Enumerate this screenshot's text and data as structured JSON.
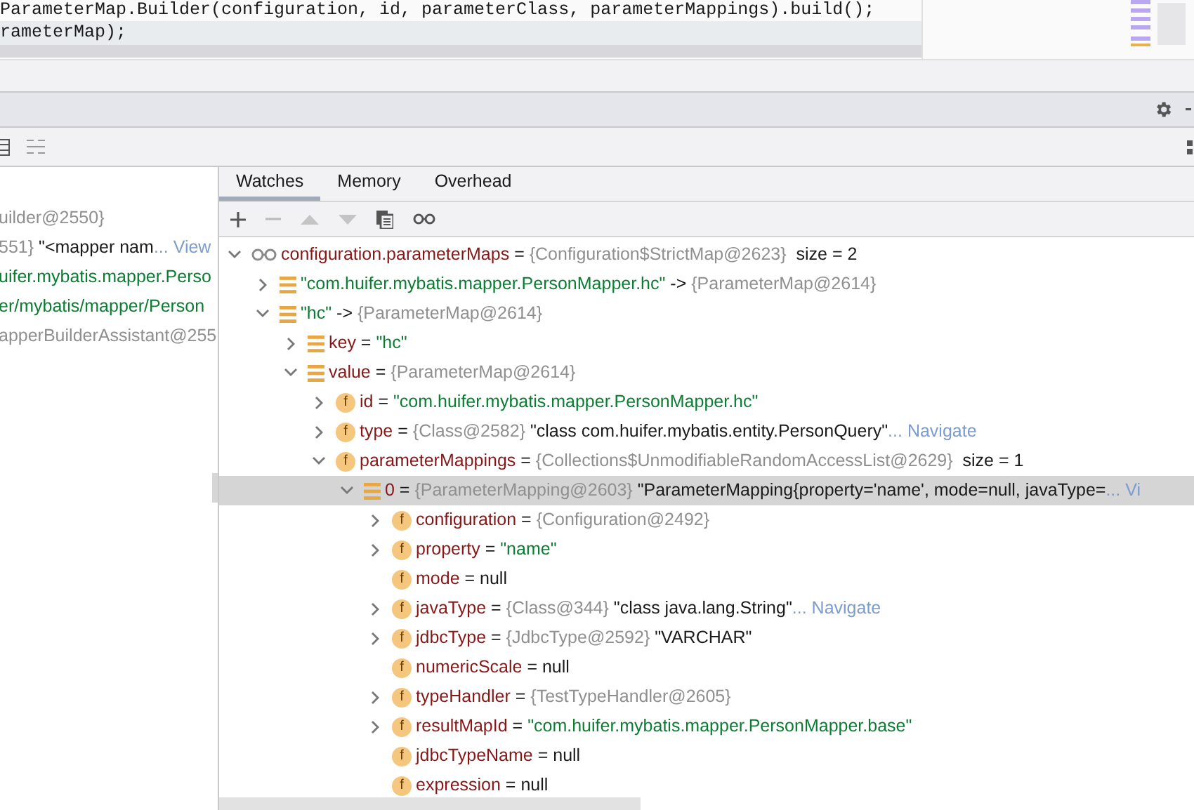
{
  "editor": {
    "lines": [
      {
        "text": "ParameterMap.Builder(configuration, id, parameterClass, parameterMappings).build();",
        "current": false
      },
      {
        "text": "rameterMap);",
        "current": true
      }
    ]
  },
  "frames": [
    {
      "parts": [
        {
          "t": "uilder@2550}",
          "kind": "ref"
        }
      ]
    },
    {
      "parts": [
        {
          "t": "551} ",
          "kind": "ref"
        },
        {
          "t": "\"<mapper nam",
          "kind": "plain"
        },
        {
          "t": "... View",
          "kind": "link"
        }
      ]
    },
    {
      "parts": [
        {
          "t": "uifer.mybatis.mapper.Perso",
          "kind": "string"
        }
      ]
    },
    {
      "parts": [
        {
          "t": "er/mybatis/mapper/Person",
          "kind": "string"
        }
      ]
    },
    {
      "parts": [
        {
          "t": "apperBuilderAssistant@255",
          "kind": "ref"
        }
      ]
    }
  ],
  "tabs": [
    {
      "label": "Watches",
      "selected": true
    },
    {
      "label": "Memory",
      "selected": false
    },
    {
      "label": "Overhead",
      "selected": false
    }
  ],
  "watches": [
    {
      "kind": "watch",
      "expanded": true,
      "selected": false,
      "parts": [
        {
          "t": "configuration.parameterMaps",
          "kind": "name"
        },
        {
          "t": " = ",
          "kind": "op"
        },
        {
          "t": "{Configuration$StrictMap@2623}",
          "kind": "ref"
        },
        {
          "t": "  size = 2",
          "kind": "plain"
        }
      ],
      "children": [
        {
          "kind": "entry",
          "expanded": false,
          "selected": false,
          "parts": [
            {
              "t": "\"com.huifer.mybatis.mapper.PersonMapper.hc\"",
              "kind": "string"
            },
            {
              "t": " -> ",
              "kind": "op"
            },
            {
              "t": "{ParameterMap@2614}",
              "kind": "ref"
            }
          ]
        },
        {
          "kind": "entry",
          "expanded": true,
          "selected": false,
          "parts": [
            {
              "t": "\"hc\"",
              "kind": "string"
            },
            {
              "t": " -> ",
              "kind": "op"
            },
            {
              "t": "{ParameterMap@2614}",
              "kind": "ref"
            }
          ],
          "children": [
            {
              "kind": "entry",
              "expanded": false,
              "selected": false,
              "parts": [
                {
                  "t": "key",
                  "kind": "name"
                },
                {
                  "t": " = ",
                  "kind": "op"
                },
                {
                  "t": "\"hc\"",
                  "kind": "string"
                }
              ]
            },
            {
              "kind": "entry",
              "expanded": true,
              "selected": false,
              "parts": [
                {
                  "t": "value",
                  "kind": "name"
                },
                {
                  "t": " = ",
                  "kind": "op"
                },
                {
                  "t": "{ParameterMap@2614}",
                  "kind": "ref"
                }
              ],
              "children": [
                {
                  "kind": "field",
                  "badge": "f",
                  "expanded": false,
                  "selected": false,
                  "parts": [
                    {
                      "t": "id",
                      "kind": "name"
                    },
                    {
                      "t": " = ",
                      "kind": "op"
                    },
                    {
                      "t": "\"com.huifer.mybatis.mapper.PersonMapper.hc\"",
                      "kind": "string"
                    }
                  ]
                },
                {
                  "kind": "field",
                  "badge": "f",
                  "expanded": false,
                  "selected": false,
                  "parts": [
                    {
                      "t": "type",
                      "kind": "name"
                    },
                    {
                      "t": " = ",
                      "kind": "op"
                    },
                    {
                      "t": "{Class@2582}",
                      "kind": "ref"
                    },
                    {
                      "t": " \"class com.huifer.mybatis.entity.PersonQuery\"",
                      "kind": "plain"
                    },
                    {
                      "t": "... Navigate",
                      "kind": "link"
                    }
                  ]
                },
                {
                  "kind": "field",
                  "badge": "f",
                  "expanded": true,
                  "selected": false,
                  "parts": [
                    {
                      "t": "parameterMappings",
                      "kind": "name"
                    },
                    {
                      "t": " = ",
                      "kind": "op"
                    },
                    {
                      "t": "{Collections$UnmodifiableRandomAccessList@2629}",
                      "kind": "ref"
                    },
                    {
                      "t": "  size = 1",
                      "kind": "plain"
                    }
                  ],
                  "children": [
                    {
                      "kind": "entry",
                      "expanded": true,
                      "selected": true,
                      "parts": [
                        {
                          "t": "0",
                          "kind": "name"
                        },
                        {
                          "t": " = ",
                          "kind": "op"
                        },
                        {
                          "t": "{ParameterMapping@2603}",
                          "kind": "ref"
                        },
                        {
                          "t": " \"ParameterMapping{property='name', mode=null, javaType=",
                          "kind": "plain"
                        },
                        {
                          "t": "... Vi",
                          "kind": "link"
                        }
                      ],
                      "children": [
                        {
                          "kind": "field",
                          "badge": "f",
                          "expanded": false,
                          "selected": false,
                          "parts": [
                            {
                              "t": "configuration",
                              "kind": "name"
                            },
                            {
                              "t": " = ",
                              "kind": "op"
                            },
                            {
                              "t": "{Configuration@2492}",
                              "kind": "ref"
                            }
                          ]
                        },
                        {
                          "kind": "field",
                          "badge": "f",
                          "expanded": false,
                          "selected": false,
                          "parts": [
                            {
                              "t": "property",
                              "kind": "name"
                            },
                            {
                              "t": " = ",
                              "kind": "op"
                            },
                            {
                              "t": "\"name\"",
                              "kind": "string"
                            }
                          ]
                        },
                        {
                          "kind": "field",
                          "badge": "f",
                          "selected": false,
                          "parts": [
                            {
                              "t": "mode",
                              "kind": "name"
                            },
                            {
                              "t": " = null",
                              "kind": "op"
                            }
                          ]
                        },
                        {
                          "kind": "field",
                          "badge": "f",
                          "expanded": false,
                          "selected": false,
                          "parts": [
                            {
                              "t": "javaType",
                              "kind": "name"
                            },
                            {
                              "t": " = ",
                              "kind": "op"
                            },
                            {
                              "t": "{Class@344}",
                              "kind": "ref"
                            },
                            {
                              "t": " \"class java.lang.String\"",
                              "kind": "plain"
                            },
                            {
                              "t": "... Navigate",
                              "kind": "link"
                            }
                          ]
                        },
                        {
                          "kind": "field",
                          "badge": "f",
                          "expanded": false,
                          "selected": false,
                          "parts": [
                            {
                              "t": "jdbcType",
                              "kind": "name"
                            },
                            {
                              "t": " = ",
                              "kind": "op"
                            },
                            {
                              "t": "{JdbcType@2592}",
                              "kind": "ref"
                            },
                            {
                              "t": " \"VARCHAR\"",
                              "kind": "plain"
                            }
                          ]
                        },
                        {
                          "kind": "field",
                          "badge": "f",
                          "selected": false,
                          "parts": [
                            {
                              "t": "numericScale",
                              "kind": "name"
                            },
                            {
                              "t": " = null",
                              "kind": "op"
                            }
                          ]
                        },
                        {
                          "kind": "field",
                          "badge": "f",
                          "expanded": false,
                          "selected": false,
                          "parts": [
                            {
                              "t": "typeHandler",
                              "kind": "name"
                            },
                            {
                              "t": " = ",
                              "kind": "op"
                            },
                            {
                              "t": "{TestTypeHandler@2605}",
                              "kind": "ref"
                            }
                          ]
                        },
                        {
                          "kind": "field",
                          "badge": "f",
                          "expanded": false,
                          "selected": false,
                          "parts": [
                            {
                              "t": "resultMapId",
                              "kind": "name"
                            },
                            {
                              "t": " = ",
                              "kind": "op"
                            },
                            {
                              "t": "\"com.huifer.mybatis.mapper.PersonMapper.base\"",
                              "kind": "string"
                            }
                          ]
                        },
                        {
                          "kind": "field",
                          "badge": "f",
                          "selected": false,
                          "parts": [
                            {
                              "t": "jdbcTypeName",
                              "kind": "name"
                            },
                            {
                              "t": " = null",
                              "kind": "op"
                            }
                          ]
                        },
                        {
                          "kind": "field",
                          "badge": "f",
                          "selected": false,
                          "parts": [
                            {
                              "t": "expression",
                              "kind": "name"
                            },
                            {
                              "t": " = null",
                              "kind": "op"
                            }
                          ]
                        }
                      ]
                    }
                  ]
                }
              ]
            }
          ]
        }
      ]
    }
  ]
}
